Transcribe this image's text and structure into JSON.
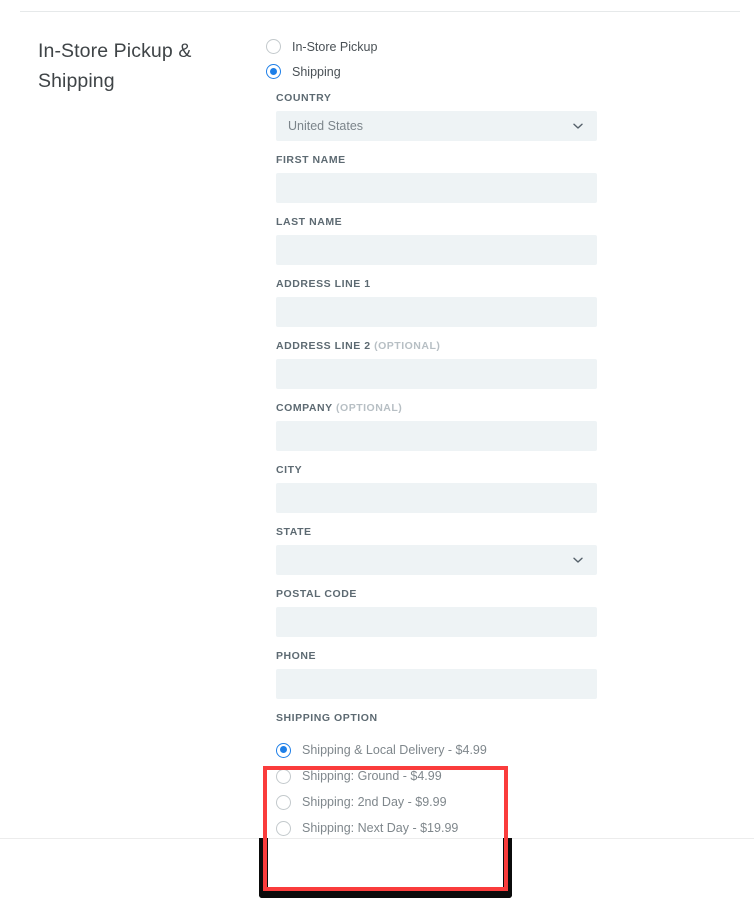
{
  "section": {
    "title": "In-Store Pickup & Shipping"
  },
  "delivery_method": {
    "options": [
      {
        "label": "In-Store Pickup",
        "selected": false
      },
      {
        "label": "Shipping",
        "selected": true
      }
    ]
  },
  "form": {
    "fields": [
      {
        "label": "COUNTRY",
        "optional": "",
        "type": "select",
        "value": "United States"
      },
      {
        "label": "FIRST NAME",
        "optional": "",
        "type": "input",
        "value": ""
      },
      {
        "label": "LAST NAME",
        "optional": "",
        "type": "input",
        "value": ""
      },
      {
        "label": "ADDRESS LINE 1",
        "optional": "",
        "type": "input",
        "value": ""
      },
      {
        "label": "ADDRESS LINE 2",
        "optional": "(OPTIONAL)",
        "type": "input",
        "value": ""
      },
      {
        "label": "COMPANY",
        "optional": "(OPTIONAL)",
        "type": "input",
        "value": ""
      },
      {
        "label": "CITY",
        "optional": "",
        "type": "input",
        "value": ""
      },
      {
        "label": "STATE",
        "optional": "",
        "type": "select",
        "value": ""
      },
      {
        "label": "POSTAL CODE",
        "optional": "",
        "type": "input",
        "value": ""
      },
      {
        "label": "PHONE",
        "optional": "",
        "type": "input",
        "value": ""
      }
    ]
  },
  "shipping_option": {
    "label": "SHIPPING OPTION",
    "options": [
      {
        "label": "Shipping & Local Delivery - $4.99",
        "selected": true
      },
      {
        "label": "Shipping: Ground - $4.99",
        "selected": false
      },
      {
        "label": "Shipping: 2nd Day - $9.99",
        "selected": false
      },
      {
        "label": "Shipping: Next Day - $19.99",
        "selected": false
      }
    ]
  },
  "annotations": {
    "highlight_color": "#fa3c3c",
    "outline_color": "#0b0b0b"
  },
  "colors": {
    "accent": "#1e7fe8",
    "field_background": "#eef3f5",
    "label_text": "#5d6a72"
  }
}
